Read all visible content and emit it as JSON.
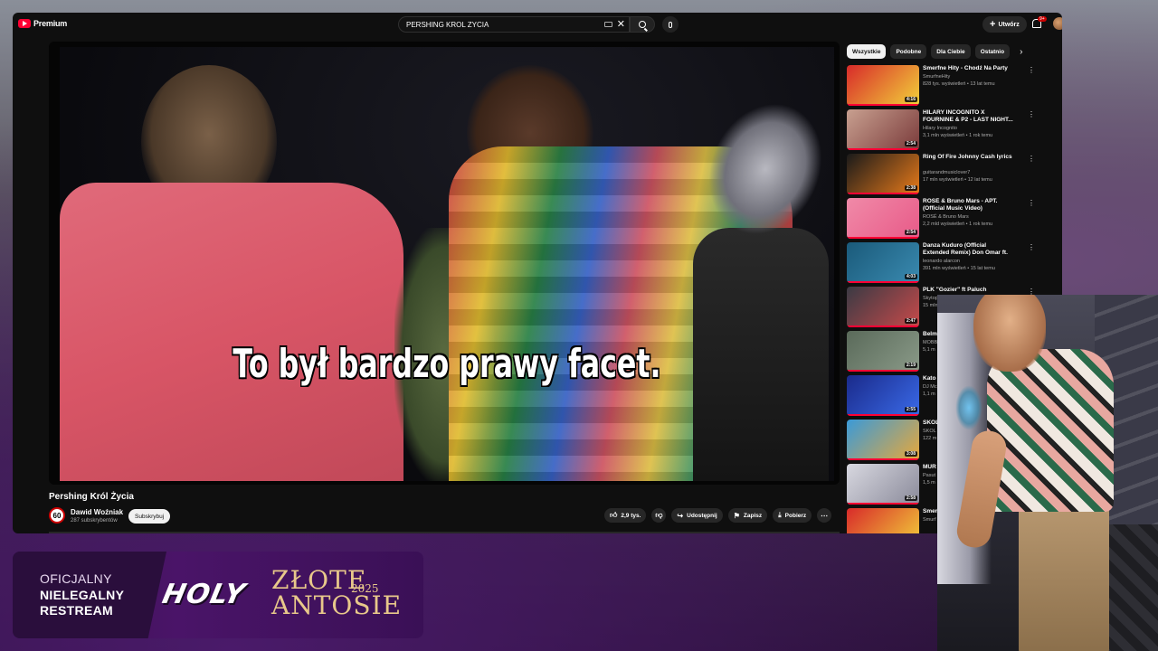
{
  "topbar": {
    "logo_text": "Premium",
    "search_value": "PERSHING KROL ZYCIA",
    "create_label": "Utwórz",
    "notifications_badge": "9+"
  },
  "video": {
    "subtitle": "To był bardzo prawy facet.",
    "title": "Pershing Król Życia",
    "channel": {
      "name": "Dawid Woźniak",
      "subscribers": "287 subskrybentów",
      "avatar_text": "60",
      "subscribe_label": "Subskrybuj"
    },
    "actions": {
      "likes": "2,9 tys.",
      "share": "Udostępnij",
      "save": "Zapisz",
      "download": "Pobierz"
    }
  },
  "sidebar": {
    "chips": [
      "Wszystkie",
      "Podobne",
      "Dla Ciebie",
      "Ostatnio"
    ],
    "recommendations": [
      {
        "title": "Smerfne Hity - Chodź Na Party",
        "channel": "SmurfneHity",
        "meta": "828 tys. wyświetleń • 13 lat temu",
        "duration": "4:16",
        "thumb": [
          "#d82a2a",
          "#f2d23a"
        ]
      },
      {
        "title": "HILARY INCOGNITO X FOURNINE & P2 - LAST NIGHT...",
        "channel": "Hilary Incognito",
        "meta": "3,1 mln wyświetleń • 1 rok temu",
        "duration": "2:54",
        "thumb": [
          "#c8a090",
          "#7a3a3a"
        ]
      },
      {
        "title": "Ring Of Fire Johnny Cash lyrics",
        "channel": "guitarandmusiclover7",
        "meta": "17 mln wyświetleń • 12 lat temu",
        "duration": "2:38",
        "thumb": [
          "#1a1a1a",
          "#e87a1a"
        ]
      },
      {
        "title": "ROSÉ & Bruno Mars - APT. (Official Music Video)",
        "channel": "ROSÉ & Bruno Mars",
        "meta": "2,2 mld wyświetleń • 1 rok temu",
        "duration": "2:54",
        "thumb": [
          "#f08aa8",
          "#e85a88"
        ]
      },
      {
        "title": "Danza Kuduro (Official Extended Remix) Don Omar ft. Lucenzo, ...",
        "channel": "leonardo alarcon",
        "meta": "391 mln wyświetleń • 15 lat temu",
        "duration": "4:03",
        "thumb": [
          "#1a5a7a",
          "#3a8ab0"
        ]
      },
      {
        "title": "PLK \"Gozier\" ft Paluch",
        "channel": "Skytop",
        "meta": "15 mln",
        "duration": "2:47",
        "thumb": [
          "#3a3a44",
          "#c84a4a"
        ]
      },
      {
        "title": "Belm",
        "channel": "MOBB",
        "meta": "5,1 m",
        "duration": "2:19",
        "thumb": [
          "#5a6a5a",
          "#8a9a88"
        ]
      },
      {
        "title": "Kato Off (D",
        "channel": "DJ Mc",
        "meta": "1,1 m",
        "duration": "2:55",
        "thumb": [
          "#1a2a8a",
          "#3a6ae8"
        ]
      },
      {
        "title": "SKOL Vide",
        "channel": "SKOL",
        "meta": "122 m",
        "duration": "3:08",
        "thumb": [
          "#3a9ad8",
          "#e8a83a"
        ]
      },
      {
        "title": "MUR",
        "channel": "Pasut",
        "meta": "1,5 m",
        "duration": "2:58",
        "thumb": [
          "#d8d8e0",
          "#8a8a9a"
        ]
      },
      {
        "title": "Smer Wsze",
        "channel": "Smurf",
        "meta": "",
        "duration": "",
        "thumb": [
          "#d82a2a",
          "#f2d23a"
        ]
      }
    ]
  },
  "branding": {
    "line1": "OFICJALNY",
    "line2": "NIELEGALNY",
    "line3": "RESTREAM",
    "holy": "HOLY",
    "zlote": "ZŁOTE",
    "antosie": "ANTOSIE",
    "year": "2025"
  }
}
